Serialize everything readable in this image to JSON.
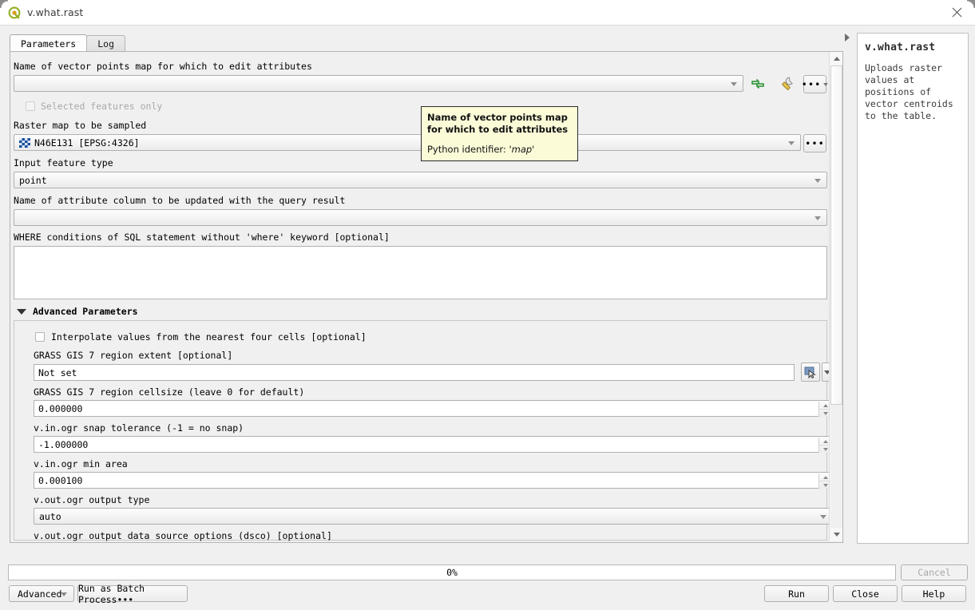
{
  "window": {
    "title": "v.what.rast",
    "logo_icon": "qgis-logo-icon",
    "close_icon": "close-icon"
  },
  "tabs": [
    {
      "label": "Parameters",
      "active": true
    },
    {
      "label": "Log",
      "active": false
    }
  ],
  "form": {
    "vector_map": {
      "label": "Name of vector points map for which to edit attributes",
      "value": "",
      "dropdown_icon": "chevron-down-icon",
      "iterate_icon": "iterate-refresh-icon",
      "advanced_icon": "wrench-icon",
      "browse_label": "•••"
    },
    "selected_only": {
      "label": "Selected features only",
      "checked": false,
      "enabled": false
    },
    "raster_map": {
      "label": "Raster map to be sampled",
      "value": "N46E131  [EPSG:4326]",
      "layer_icon": "raster-layer-icon",
      "browse_label": "•••"
    },
    "feature_type": {
      "label": "Input feature type",
      "value": "point"
    },
    "attribute_column": {
      "label": "Name of attribute column to be updated with the query result",
      "value": ""
    },
    "where": {
      "label": "WHERE conditions of SQL statement without 'where' keyword [optional]",
      "value": ""
    }
  },
  "advanced": {
    "header": "Advanced Parameters",
    "collapse_icon": "caret-down-icon",
    "interpolate": {
      "label": "Interpolate values from the nearest four cells [optional]",
      "checked": false
    },
    "region_extent": {
      "label": "GRASS GIS 7 region extent [optional]",
      "value": "Not set",
      "select_icon": "select-extent-on-canvas-icon",
      "menu_icon": "chevron-down-icon"
    },
    "region_cellsize": {
      "label": "GRASS GIS 7 region cellsize (leave 0 for default)",
      "value": "0.000000"
    },
    "snap_tolerance": {
      "label": "v.in.ogr snap tolerance (-1 = no snap)",
      "value": "-1.000000"
    },
    "min_area": {
      "label": "v.in.ogr min area",
      "value": "0.000100"
    },
    "output_type": {
      "label": "v.out.ogr output type",
      "value": "auto"
    },
    "dsco": {
      "label": "v.out.ogr output data source options (dsco) [optional]"
    }
  },
  "tooltip": {
    "heading": "Name of vector points map for which to edit attributes",
    "python_label": "Python identifier: ",
    "python_value": "'map'"
  },
  "help": {
    "title": "v.what.rast",
    "body": "Uploads raster values at positions of vector centroids to the table."
  },
  "footer": {
    "progress_text": "0%",
    "progress_value": 0,
    "cancel_label": "Cancel",
    "cancel_enabled": false,
    "advanced_label": "Advanced",
    "batch_label": "Run as Batch Process•••",
    "run_label": "Run",
    "close_label": "Close",
    "help_label": "Help"
  },
  "scrollbar": {
    "up_icon": "scroll-up-arrow-icon",
    "down_icon": "scroll-down-arrow-icon"
  }
}
